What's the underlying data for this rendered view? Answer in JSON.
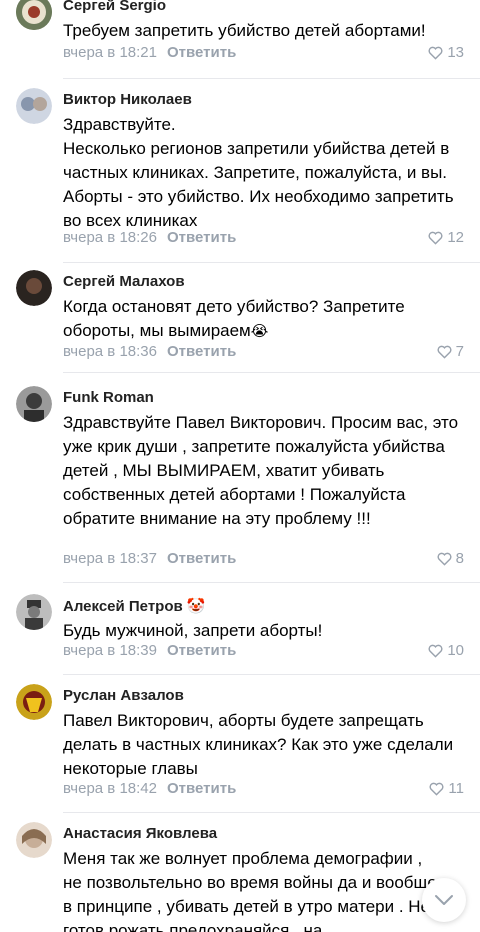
{
  "comments": [
    {
      "author": "Сергей Sergio",
      "text": "Требуем запретить убийство детей абортами!",
      "time": "вчера в 18:21",
      "reply": "Ответить",
      "likes": "13",
      "avatar_color": "#6b7a5a"
    },
    {
      "author": "Виктор Николаев",
      "text": "Здравствуйте.\nНесколько регионов запретили убийства детей в частных клиниках. Запретите, пожалуйста, и вы. Аборты - это убийство. Их необходимо запретить во всех клиниках",
      "time": "вчера в 18:26",
      "reply": "Ответить",
      "likes": "12",
      "avatar_color": "#a7b1c4"
    },
    {
      "author": "Сергей Малахов",
      "text": "Когда остановят дето убийство? Запретите обороты, мы вымираем",
      "emoji": "😭",
      "time": "вчера в 18:36",
      "reply": "Ответить",
      "likes": "7",
      "avatar_color": "#2a2420"
    },
    {
      "author": "Funk Roman",
      "text": "Здравствуйте Павел Викторович.  Просим вас, это уже крик  души , запретите пожалуйста убийства детей , МЫ ВЫМИРАЕМ, хватит убивать собственных детей абортами  ! Пожалуйста обратите внимание на эту проблему !!!",
      "time": "вчера в 18:37",
      "reply": "Ответить",
      "likes": "8",
      "avatar_color": "#4a4a4a"
    },
    {
      "author": "Алексей Петров",
      "author_emoji": "🤡",
      "text": "Будь мужчиной, запрети аборты!",
      "time": "вчера в 18:39",
      "reply": "Ответить",
      "likes": "10",
      "avatar_color": "#5c5c5c"
    },
    {
      "author": "Руслан Авзалов",
      "text": "Павел Викторович, аборты будете запрещать делать в частных клиниках? Как это уже сделали некоторые главы",
      "time": "вчера в 18:42",
      "reply": "Ответить",
      "likes": "11",
      "avatar_color": "#c9a21a"
    },
    {
      "author": "Анастасия Яковлева",
      "text": "Меня так же волнует проблема демографии , не позвольтельно во время войны да и вообще в принципе , убивать  детей в утро матери . Не готов рожать предохраняйся , на",
      "avatar_color": "#d8c8b8"
    }
  ],
  "scroll_button_icon": "chevron-down-icon"
}
